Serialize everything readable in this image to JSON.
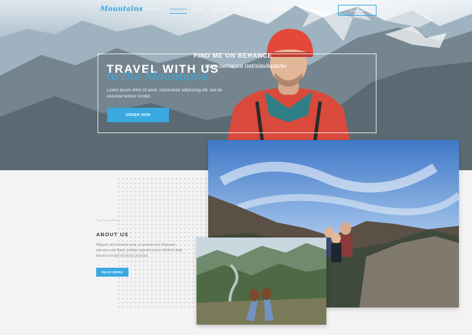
{
  "nav": {
    "logo": "Mountains",
    "items": [
      {
        "label": "OUR STORY"
      },
      {
        "label": "SERVICES",
        "active": true
      },
      {
        "label": "WORK"
      },
      {
        "label": "JOURNAL"
      },
      {
        "label": "CONTACT"
      },
      {
        "label": "WORK"
      },
      {
        "label": "JOURNAL"
      }
    ],
    "cta_label": "CALL US"
  },
  "hero": {
    "title": "TRAVEL WITH US",
    "script_title": "to the Mountains",
    "text": "Lorem ipsum dolor sit amet, consectetur adipisicing elit, sed do eiusmod tempor incidid.",
    "button_label": "ORDER NOW",
    "overlay_line1": "FIND ME ON BEHANCE",
    "overlay_line2": "www.behance.net/slavikpavliv"
  },
  "about": {
    "title": "ABOUT US",
    "text": "Aliquam sed posuere urna, et gravida nisl. Praesent interdum nisl libero, pretium egestas purus eleifend vitae. Mauris suscipit vel lectus at luctus.",
    "button_label": "READ MORE"
  },
  "colors": {
    "accent": "#3aa9e0",
    "background": "#f4f3f4",
    "text_dark": "#333333"
  }
}
